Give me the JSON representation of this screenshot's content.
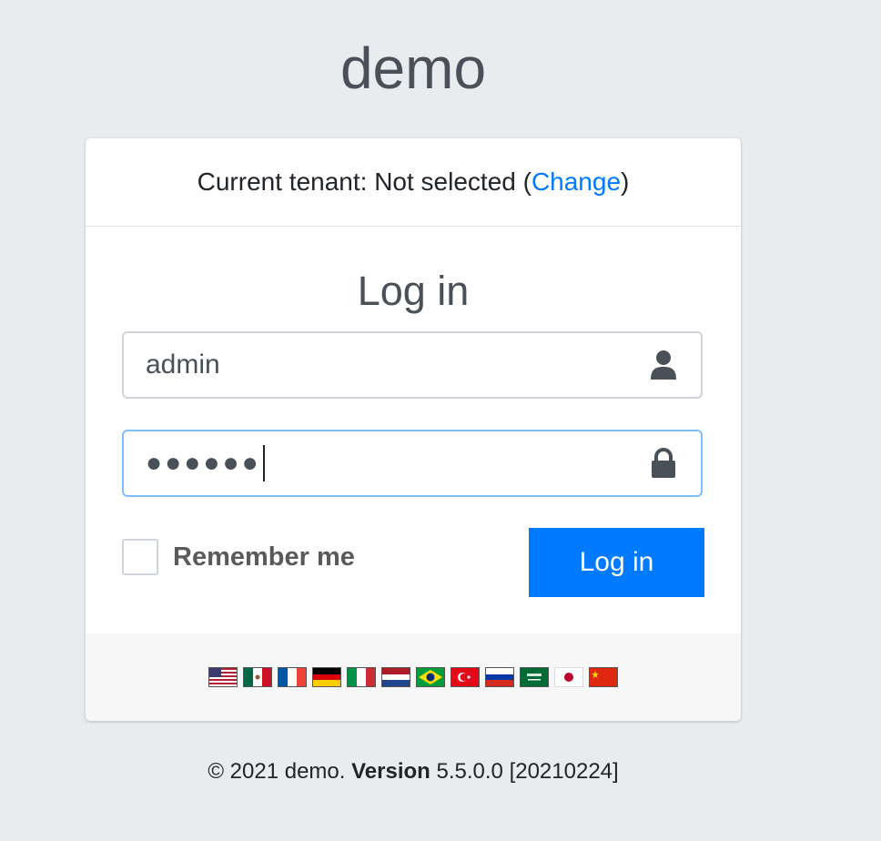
{
  "brand": "demo",
  "tenant": {
    "prefix": "Current tenant: Not selected (",
    "change_link": "Change",
    "suffix": ")"
  },
  "login": {
    "title": "Log in",
    "username_value": "admin",
    "password_mask": "●●●●●●",
    "remember_label": "Remember me",
    "submit_label": "Log in"
  },
  "languages": [
    {
      "code": "en",
      "icon": "flag-us-icon"
    },
    {
      "code": "es-MX",
      "icon": "flag-mexico-icon"
    },
    {
      "code": "fr",
      "icon": "flag-france-icon"
    },
    {
      "code": "de",
      "icon": "flag-germany-icon"
    },
    {
      "code": "it",
      "icon": "flag-italy-icon"
    },
    {
      "code": "nl",
      "icon": "flag-netherlands-icon"
    },
    {
      "code": "pt-BR",
      "icon": "flag-brazil-icon"
    },
    {
      "code": "tr",
      "icon": "flag-turkey-icon"
    },
    {
      "code": "ru",
      "icon": "flag-russia-icon"
    },
    {
      "code": "ar",
      "icon": "flag-saudi-arabia-icon"
    },
    {
      "code": "ja",
      "icon": "flag-japan-icon"
    },
    {
      "code": "zh-CN",
      "icon": "flag-china-icon"
    }
  ],
  "footer": {
    "copyright": "© 2021 demo.",
    "version_label": "Version",
    "version_value": "5.5.0.0 [20210224]"
  },
  "colors": {
    "accent": "#007bff",
    "background": "#e9ecef",
    "focus_border": "#80bdff"
  }
}
